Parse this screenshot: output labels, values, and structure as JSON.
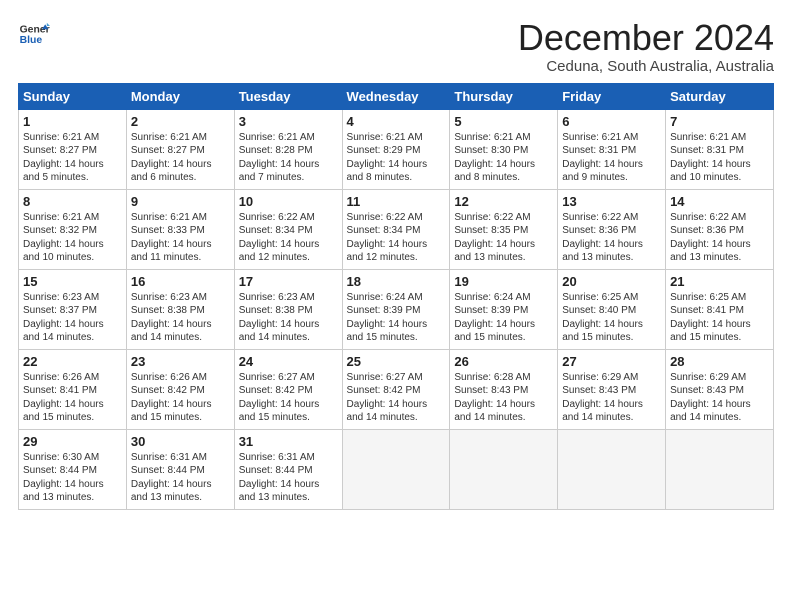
{
  "logo": {
    "line1": "General",
    "line2": "Blue"
  },
  "title": "December 2024",
  "subtitle": "Ceduna, South Australia, Australia",
  "days_header": [
    "Sunday",
    "Monday",
    "Tuesday",
    "Wednesday",
    "Thursday",
    "Friday",
    "Saturday"
  ],
  "weeks": [
    [
      {
        "day": "1",
        "info": "Sunrise: 6:21 AM\nSunset: 8:27 PM\nDaylight: 14 hours\nand 5 minutes."
      },
      {
        "day": "2",
        "info": "Sunrise: 6:21 AM\nSunset: 8:27 PM\nDaylight: 14 hours\nand 6 minutes."
      },
      {
        "day": "3",
        "info": "Sunrise: 6:21 AM\nSunset: 8:28 PM\nDaylight: 14 hours\nand 7 minutes."
      },
      {
        "day": "4",
        "info": "Sunrise: 6:21 AM\nSunset: 8:29 PM\nDaylight: 14 hours\nand 8 minutes."
      },
      {
        "day": "5",
        "info": "Sunrise: 6:21 AM\nSunset: 8:30 PM\nDaylight: 14 hours\nand 8 minutes."
      },
      {
        "day": "6",
        "info": "Sunrise: 6:21 AM\nSunset: 8:31 PM\nDaylight: 14 hours\nand 9 minutes."
      },
      {
        "day": "7",
        "info": "Sunrise: 6:21 AM\nSunset: 8:31 PM\nDaylight: 14 hours\nand 10 minutes."
      }
    ],
    [
      {
        "day": "8",
        "info": "Sunrise: 6:21 AM\nSunset: 8:32 PM\nDaylight: 14 hours\nand 10 minutes."
      },
      {
        "day": "9",
        "info": "Sunrise: 6:21 AM\nSunset: 8:33 PM\nDaylight: 14 hours\nand 11 minutes."
      },
      {
        "day": "10",
        "info": "Sunrise: 6:22 AM\nSunset: 8:34 PM\nDaylight: 14 hours\nand 12 minutes."
      },
      {
        "day": "11",
        "info": "Sunrise: 6:22 AM\nSunset: 8:34 PM\nDaylight: 14 hours\nand 12 minutes."
      },
      {
        "day": "12",
        "info": "Sunrise: 6:22 AM\nSunset: 8:35 PM\nDaylight: 14 hours\nand 13 minutes."
      },
      {
        "day": "13",
        "info": "Sunrise: 6:22 AM\nSunset: 8:36 PM\nDaylight: 14 hours\nand 13 minutes."
      },
      {
        "day": "14",
        "info": "Sunrise: 6:22 AM\nSunset: 8:36 PM\nDaylight: 14 hours\nand 13 minutes."
      }
    ],
    [
      {
        "day": "15",
        "info": "Sunrise: 6:23 AM\nSunset: 8:37 PM\nDaylight: 14 hours\nand 14 minutes."
      },
      {
        "day": "16",
        "info": "Sunrise: 6:23 AM\nSunset: 8:38 PM\nDaylight: 14 hours\nand 14 minutes."
      },
      {
        "day": "17",
        "info": "Sunrise: 6:23 AM\nSunset: 8:38 PM\nDaylight: 14 hours\nand 14 minutes."
      },
      {
        "day": "18",
        "info": "Sunrise: 6:24 AM\nSunset: 8:39 PM\nDaylight: 14 hours\nand 15 minutes."
      },
      {
        "day": "19",
        "info": "Sunrise: 6:24 AM\nSunset: 8:39 PM\nDaylight: 14 hours\nand 15 minutes."
      },
      {
        "day": "20",
        "info": "Sunrise: 6:25 AM\nSunset: 8:40 PM\nDaylight: 14 hours\nand 15 minutes."
      },
      {
        "day": "21",
        "info": "Sunrise: 6:25 AM\nSunset: 8:41 PM\nDaylight: 14 hours\nand 15 minutes."
      }
    ],
    [
      {
        "day": "22",
        "info": "Sunrise: 6:26 AM\nSunset: 8:41 PM\nDaylight: 14 hours\nand 15 minutes."
      },
      {
        "day": "23",
        "info": "Sunrise: 6:26 AM\nSunset: 8:42 PM\nDaylight: 14 hours\nand 15 minutes."
      },
      {
        "day": "24",
        "info": "Sunrise: 6:27 AM\nSunset: 8:42 PM\nDaylight: 14 hours\nand 15 minutes."
      },
      {
        "day": "25",
        "info": "Sunrise: 6:27 AM\nSunset: 8:42 PM\nDaylight: 14 hours\nand 14 minutes."
      },
      {
        "day": "26",
        "info": "Sunrise: 6:28 AM\nSunset: 8:43 PM\nDaylight: 14 hours\nand 14 minutes."
      },
      {
        "day": "27",
        "info": "Sunrise: 6:29 AM\nSunset: 8:43 PM\nDaylight: 14 hours\nand 14 minutes."
      },
      {
        "day": "28",
        "info": "Sunrise: 6:29 AM\nSunset: 8:43 PM\nDaylight: 14 hours\nand 14 minutes."
      }
    ],
    [
      {
        "day": "29",
        "info": "Sunrise: 6:30 AM\nSunset: 8:44 PM\nDaylight: 14 hours\nand 13 minutes."
      },
      {
        "day": "30",
        "info": "Sunrise: 6:31 AM\nSunset: 8:44 PM\nDaylight: 14 hours\nand 13 minutes."
      },
      {
        "day": "31",
        "info": "Sunrise: 6:31 AM\nSunset: 8:44 PM\nDaylight: 14 hours\nand 13 minutes."
      },
      {
        "day": "",
        "info": ""
      },
      {
        "day": "",
        "info": ""
      },
      {
        "day": "",
        "info": ""
      },
      {
        "day": "",
        "info": ""
      }
    ]
  ]
}
